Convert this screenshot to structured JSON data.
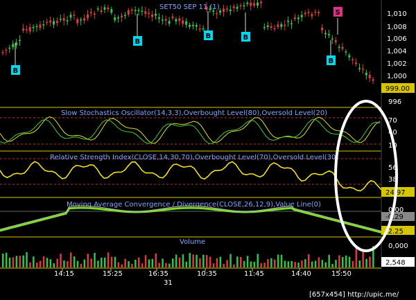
{
  "chart_data": [
    {
      "type": "candlestick",
      "title": "SET50 SEP 11 (1)",
      "y_ticks": [
        "1,010",
        "1,008",
        "1,006",
        "1,004",
        "1,002",
        "1,000"
      ],
      "y_ticks_values": [
        1010,
        1008,
        1006,
        1004,
        1002,
        1000
      ],
      "last_value_label": "999.00",
      "markers": [
        {
          "label": "B"
        },
        {
          "label": "B"
        },
        {
          "label": "B"
        },
        {
          "label": "B"
        },
        {
          "label": "S"
        },
        {
          "label": "B"
        }
      ]
    },
    {
      "type": "line",
      "title": "Slow Stochastics Oscillator(14,3,3),Overbought Level(80),Oversold Level(20)",
      "y_ticks": [
        "996",
        "70",
        "40",
        "10"
      ]
    },
    {
      "type": "line",
      "title": "Relative Strength Index(CLOSE,14,30,70),Overbought Level(70),Oversold Level(30)",
      "y_ticks": [
        "56",
        "38"
      ],
      "last_value_label": "24.97"
    },
    {
      "type": "line",
      "title": "Moving Average Convergence / Divergence(CLOSE,26,12,9),Value Line(0)",
      "y_ticks": [
        "0.00"
      ],
      "value_labels": [
        "-0.29",
        "-2.25"
      ]
    },
    {
      "type": "bar",
      "title": "Volume",
      "y_ticks": [
        "0,000"
      ],
      "last_value_label": "2,548"
    }
  ],
  "x_axis": {
    "ticks": [
      "14:15",
      "15:25",
      "16:35",
      "10:35",
      "11:45",
      "14:40",
      "15:50"
    ],
    "date_label": "31"
  },
  "watermark": "[657x454] http://upic.me/",
  "colors": {
    "bg": "#000000",
    "panel_border": "#d6c600",
    "up": "#2fc64a",
    "down": "#e23a3a",
    "title": "#7fa7ff",
    "buy_marker": "#00d8f0",
    "sell_marker": "#e0308a",
    "overlay_circle": "#ffffff"
  }
}
